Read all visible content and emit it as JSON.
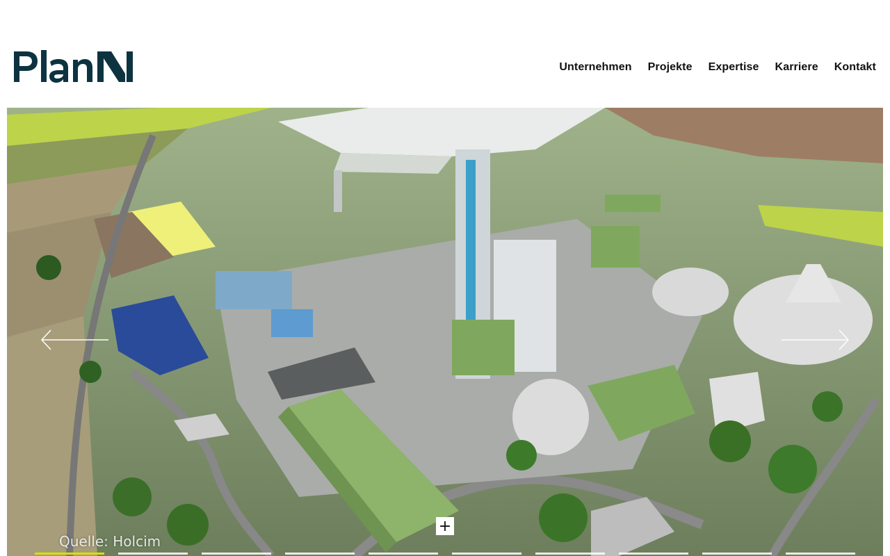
{
  "brand": {
    "logo_text": "PlanN",
    "color": "#0d3340"
  },
  "nav": {
    "items": [
      {
        "label": "Unternehmen"
      },
      {
        "label": "Projekte"
      },
      {
        "label": "Expertise"
      },
      {
        "label": "Karriere"
      },
      {
        "label": "Kontakt"
      }
    ]
  },
  "hero": {
    "caption": "Quelle: Holcim",
    "plus_label": "+",
    "prev_icon": "arrow-left-icon",
    "next_icon": "arrow-right-icon",
    "slide_count": 10,
    "active_slide": 1,
    "accent_color": "#d6e000"
  }
}
